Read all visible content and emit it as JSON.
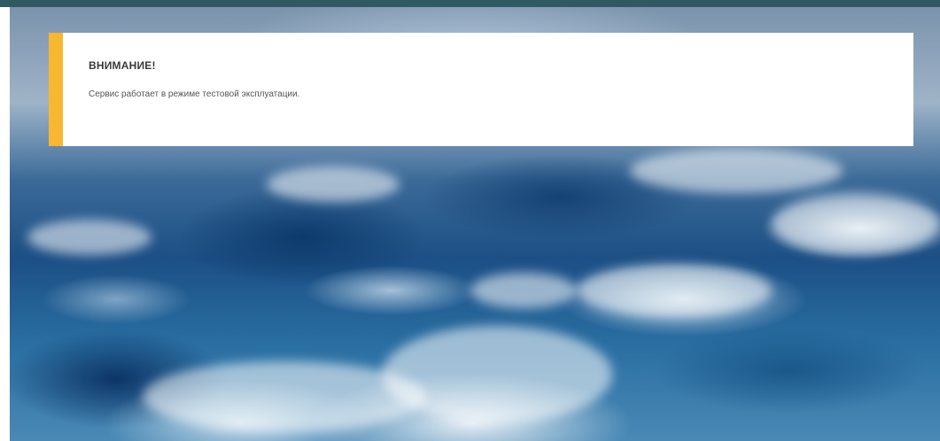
{
  "alert": {
    "title": "ВНИМАНИЕ!",
    "message": "Сервис работает в режиме тестовой эксплуатации."
  },
  "colors": {
    "top_bar": "#2f5a62",
    "alert_accent": "#f7b731",
    "alert_background": "#ffffff"
  }
}
